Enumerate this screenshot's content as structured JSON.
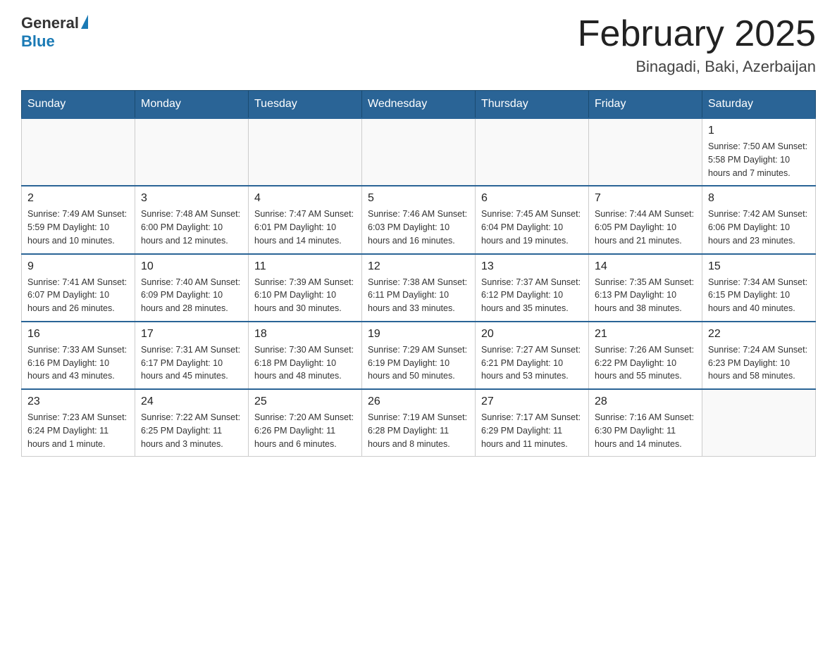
{
  "header": {
    "logo_general": "General",
    "logo_blue": "Blue",
    "month_title": "February 2025",
    "location": "Binagadi, Baki, Azerbaijan"
  },
  "days_of_week": [
    "Sunday",
    "Monday",
    "Tuesday",
    "Wednesday",
    "Thursday",
    "Friday",
    "Saturday"
  ],
  "weeks": [
    [
      {
        "day": "",
        "info": ""
      },
      {
        "day": "",
        "info": ""
      },
      {
        "day": "",
        "info": ""
      },
      {
        "day": "",
        "info": ""
      },
      {
        "day": "",
        "info": ""
      },
      {
        "day": "",
        "info": ""
      },
      {
        "day": "1",
        "info": "Sunrise: 7:50 AM\nSunset: 5:58 PM\nDaylight: 10 hours and 7 minutes."
      }
    ],
    [
      {
        "day": "2",
        "info": "Sunrise: 7:49 AM\nSunset: 5:59 PM\nDaylight: 10 hours and 10 minutes."
      },
      {
        "day": "3",
        "info": "Sunrise: 7:48 AM\nSunset: 6:00 PM\nDaylight: 10 hours and 12 minutes."
      },
      {
        "day": "4",
        "info": "Sunrise: 7:47 AM\nSunset: 6:01 PM\nDaylight: 10 hours and 14 minutes."
      },
      {
        "day": "5",
        "info": "Sunrise: 7:46 AM\nSunset: 6:03 PM\nDaylight: 10 hours and 16 minutes."
      },
      {
        "day": "6",
        "info": "Sunrise: 7:45 AM\nSunset: 6:04 PM\nDaylight: 10 hours and 19 minutes."
      },
      {
        "day": "7",
        "info": "Sunrise: 7:44 AM\nSunset: 6:05 PM\nDaylight: 10 hours and 21 minutes."
      },
      {
        "day": "8",
        "info": "Sunrise: 7:42 AM\nSunset: 6:06 PM\nDaylight: 10 hours and 23 minutes."
      }
    ],
    [
      {
        "day": "9",
        "info": "Sunrise: 7:41 AM\nSunset: 6:07 PM\nDaylight: 10 hours and 26 minutes."
      },
      {
        "day": "10",
        "info": "Sunrise: 7:40 AM\nSunset: 6:09 PM\nDaylight: 10 hours and 28 minutes."
      },
      {
        "day": "11",
        "info": "Sunrise: 7:39 AM\nSunset: 6:10 PM\nDaylight: 10 hours and 30 minutes."
      },
      {
        "day": "12",
        "info": "Sunrise: 7:38 AM\nSunset: 6:11 PM\nDaylight: 10 hours and 33 minutes."
      },
      {
        "day": "13",
        "info": "Sunrise: 7:37 AM\nSunset: 6:12 PM\nDaylight: 10 hours and 35 minutes."
      },
      {
        "day": "14",
        "info": "Sunrise: 7:35 AM\nSunset: 6:13 PM\nDaylight: 10 hours and 38 minutes."
      },
      {
        "day": "15",
        "info": "Sunrise: 7:34 AM\nSunset: 6:15 PM\nDaylight: 10 hours and 40 minutes."
      }
    ],
    [
      {
        "day": "16",
        "info": "Sunrise: 7:33 AM\nSunset: 6:16 PM\nDaylight: 10 hours and 43 minutes."
      },
      {
        "day": "17",
        "info": "Sunrise: 7:31 AM\nSunset: 6:17 PM\nDaylight: 10 hours and 45 minutes."
      },
      {
        "day": "18",
        "info": "Sunrise: 7:30 AM\nSunset: 6:18 PM\nDaylight: 10 hours and 48 minutes."
      },
      {
        "day": "19",
        "info": "Sunrise: 7:29 AM\nSunset: 6:19 PM\nDaylight: 10 hours and 50 minutes."
      },
      {
        "day": "20",
        "info": "Sunrise: 7:27 AM\nSunset: 6:21 PM\nDaylight: 10 hours and 53 minutes."
      },
      {
        "day": "21",
        "info": "Sunrise: 7:26 AM\nSunset: 6:22 PM\nDaylight: 10 hours and 55 minutes."
      },
      {
        "day": "22",
        "info": "Sunrise: 7:24 AM\nSunset: 6:23 PM\nDaylight: 10 hours and 58 minutes."
      }
    ],
    [
      {
        "day": "23",
        "info": "Sunrise: 7:23 AM\nSunset: 6:24 PM\nDaylight: 11 hours and 1 minute."
      },
      {
        "day": "24",
        "info": "Sunrise: 7:22 AM\nSunset: 6:25 PM\nDaylight: 11 hours and 3 minutes."
      },
      {
        "day": "25",
        "info": "Sunrise: 7:20 AM\nSunset: 6:26 PM\nDaylight: 11 hours and 6 minutes."
      },
      {
        "day": "26",
        "info": "Sunrise: 7:19 AM\nSunset: 6:28 PM\nDaylight: 11 hours and 8 minutes."
      },
      {
        "day": "27",
        "info": "Sunrise: 7:17 AM\nSunset: 6:29 PM\nDaylight: 11 hours and 11 minutes."
      },
      {
        "day": "28",
        "info": "Sunrise: 7:16 AM\nSunset: 6:30 PM\nDaylight: 11 hours and 14 minutes."
      },
      {
        "day": "",
        "info": ""
      }
    ]
  ]
}
